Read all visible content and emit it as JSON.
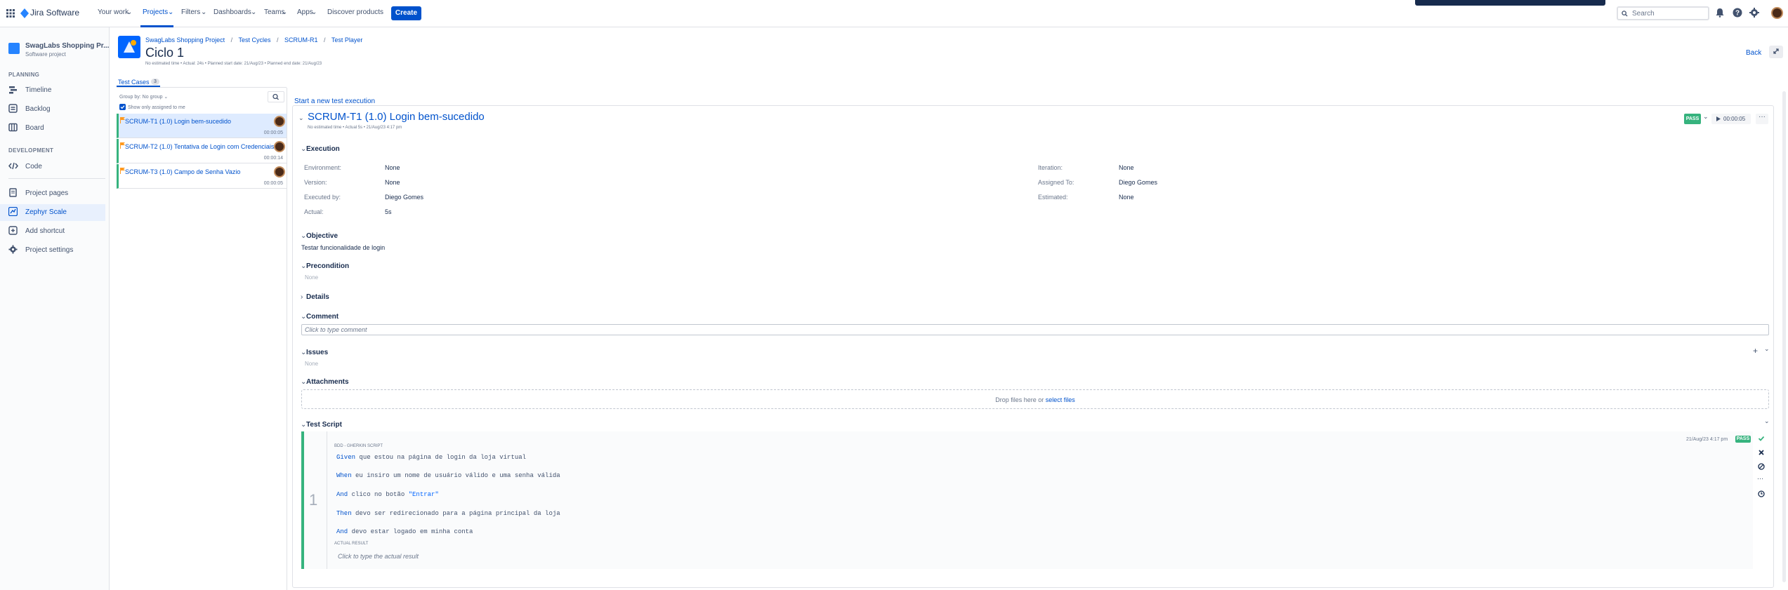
{
  "topnav": {
    "product": "Jira Software",
    "items": [
      "Your work",
      "Projects",
      "Filters",
      "Dashboards",
      "Teams",
      "Apps"
    ],
    "discover": "Discover products",
    "create": "Create",
    "search_placeholder": "Search"
  },
  "sidebar": {
    "project_name": "SwagLabs Shopping Pr...",
    "project_type": "Software project",
    "planning_heading": "PLANNING",
    "planning": [
      "Timeline",
      "Backlog",
      "Board"
    ],
    "development_heading": "DEVELOPMENT",
    "development": [
      "Code"
    ],
    "other": [
      "Project pages",
      "Zephyr Scale",
      "Add shortcut",
      "Project settings"
    ]
  },
  "header": {
    "breadcrumb": [
      "SwagLabs Shopping Project",
      "Test Cycles",
      "SCRUM-R1",
      "Test Player"
    ],
    "title": "Ciclo 1",
    "meta": "No estimated time  •  Actual: 24s  •  Planned start date: 21/Aug/23  •  Planned end date: 21/Aug/23",
    "back": "Back"
  },
  "left_panel": {
    "tab": "Test Cases",
    "count": "3",
    "group_by": "Group by: No group",
    "only_assigned": "Show only assigned to me",
    "test_cases": [
      {
        "name": "SCRUM-T1 (1.0) Login bem-sucedido",
        "time": "00:00:05"
      },
      {
        "name": "SCRUM-T2 (1.0) Tentativa de Login com Credenciais",
        "time": "00:00:14"
      },
      {
        "name": "SCRUM-T3 (1.0) Campo de Senha Vazio",
        "time": "00:00:05"
      }
    ]
  },
  "detail": {
    "start_new": "Start a new test execution",
    "title": "SCRUM-T1 (1.0) Login bem-sucedido",
    "meta": "No estimated time  •  Actual 5s  •  21/Aug/23 4:17 pm",
    "status": "PASS",
    "timer": "00:00:05",
    "execution_heading": "Execution",
    "fields_left": [
      {
        "label": "Environment:",
        "value": "None"
      },
      {
        "label": "Version:",
        "value": "None"
      },
      {
        "label": "Executed by:",
        "value": "Diego Gomes"
      },
      {
        "label": "Actual:",
        "value": "5s"
      }
    ],
    "fields_right": [
      {
        "label": "Iteration:",
        "value": "None"
      },
      {
        "label": "Assigned To:",
        "value": "Diego Gomes"
      },
      {
        "label": "Estimated:",
        "value": "None"
      }
    ],
    "objective_heading": "Objective",
    "objective": "Testar funcionalidade de login",
    "precondition_heading": "Precondition",
    "precondition": "None",
    "details_heading": "Details",
    "comment_heading": "Comment",
    "comment_placeholder": "Click to type comment",
    "issues_heading": "Issues",
    "issues": "None",
    "attachments_heading": "Attachments",
    "drop_text": "Drop files here or",
    "select_files": "select files",
    "script_heading": "Test Script",
    "step": {
      "number": "1",
      "label": "BDD - GHERKIN SCRIPT",
      "date": "21/Aug/23 4:17 pm",
      "status": "PASS",
      "lines": [
        {
          "kw": "Given",
          "text": " que estou na página de login da loja virtual",
          "str": ""
        },
        {
          "kw": "When",
          "text": " eu insiro um nome de usuário válido e uma senha válida",
          "str": ""
        },
        {
          "kw": "And",
          "text": " clico no botão ",
          "str": "\"Entrar\""
        },
        {
          "kw": "Then",
          "text": " devo ser redirecionado para a página principal da loja",
          "str": ""
        },
        {
          "kw": "And",
          "text": " devo estar logado em minha conta",
          "str": ""
        }
      ],
      "actual_label": "ACTUAL RESULT",
      "actual_placeholder": "Click to type the actual result"
    }
  }
}
